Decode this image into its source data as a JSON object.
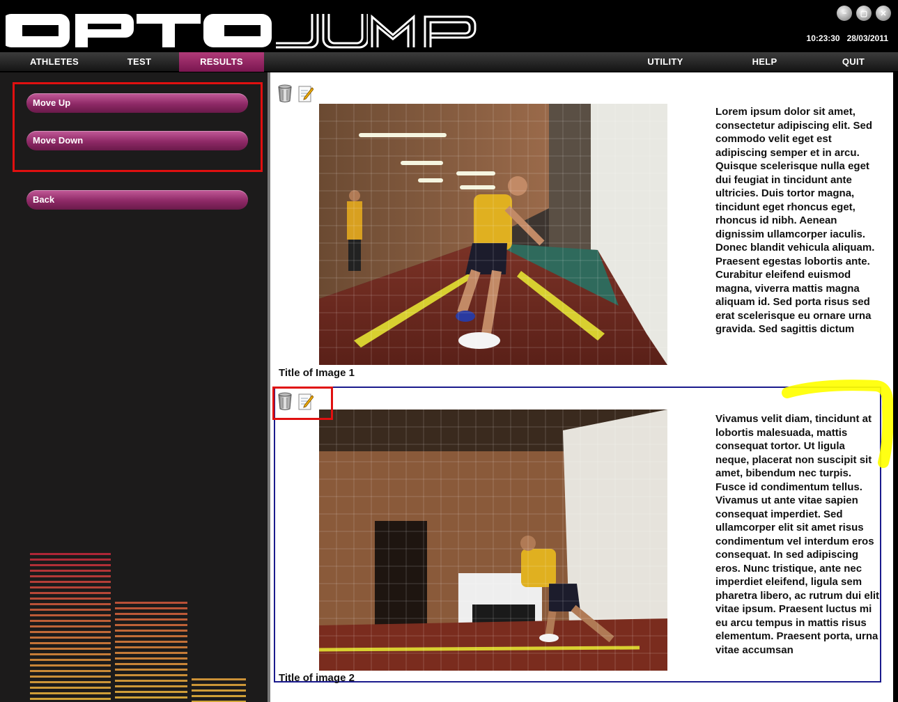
{
  "header": {
    "app_name": "OPTOJUMP",
    "time": "10:23:30",
    "date": "28/03/2011",
    "window_buttons": [
      "minimize-icon",
      "maximize-icon",
      "close-icon"
    ]
  },
  "nav": {
    "athletes": "ATHLETES",
    "test": "TEST",
    "results": "RESULTS",
    "utility": "UTILITY",
    "help": "HELP",
    "quit": "QUIT",
    "active": "RESULTS"
  },
  "sidebar": {
    "move_up": "Move Up",
    "move_down": "Move Down",
    "back": "Back"
  },
  "entries": [
    {
      "caption": "Title of Image 1",
      "text": "Lorem ipsum dolor sit amet, consectetur adipiscing elit. Sed commodo velit eget est adipiscing semper et in arcu. Quisque scelerisque nulla eget dui feugiat in tincidunt ante ultricies. Duis tortor magna, tincidunt eget rhoncus eget, rhoncus id nibh. Aenean dignissim ullamcorper iaculis. Donec blandit vehicula aliquam. Praesent egestas lobortis ante. Curabitur eleifend euismod magna, viverra mattis magna aliquam id. Sed porta risus sed erat scelerisque eu ornare urna gravida. Sed sagittis dictum"
    },
    {
      "caption": "Title of image 2",
      "text": "Vivamus velit diam, tincidunt at lobortis malesuada, mattis consequat tortor. Ut ligula neque, placerat non suscipit sit amet, bibendum nec turpis. Fusce id condimentum tellus. Vivamus ut ante vitae sapien consequat imperdiet. Sed ullamcorper elit sit amet risus condimentum vel interdum eros consequat. In sed adipiscing eros. Nunc tristique, ante nec imperdiet eleifend, ligula sem pharetra libero, ac rutrum dui elit vitae ipsum. Praesent luctus mi eu arcu tempus in mattis risus elementum. Praesent porta, urna vitae accumsan"
    }
  ],
  "colors": {
    "accent": "#8e2966",
    "selection_outline": "#e01010",
    "selected_entry_border": "#1a1a8c",
    "highlight": "#ffff00"
  }
}
